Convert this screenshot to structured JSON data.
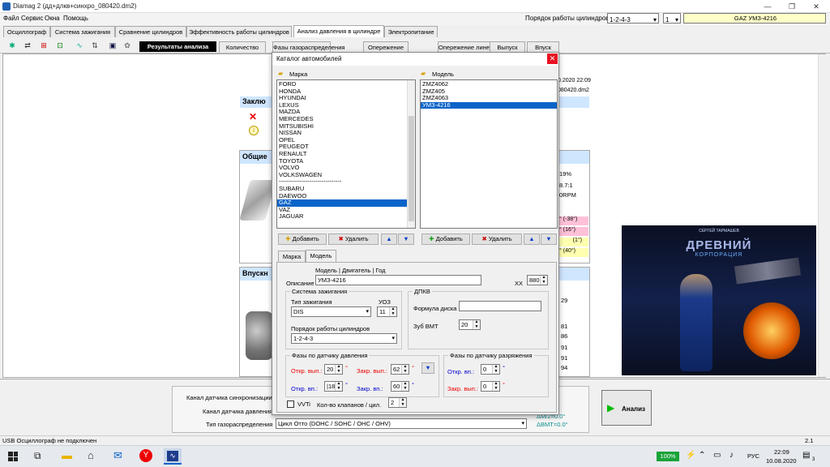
{
  "window": {
    "title": "Diamag 2 (дд+длкв+синхро_080420.dm2)"
  },
  "menu": [
    "Файл",
    "Сервис",
    "Окна",
    "Помощь"
  ],
  "header": {
    "firing_order_label": "Порядок работы цилиндров",
    "firing_order_value": "1-2-4-3",
    "cylinder_value": "1",
    "car_model": "GAZ УМЗ-4216"
  },
  "main_tabs": [
    "Осциллограф",
    "Система зажигания",
    "Сравнение цилиндров",
    "Эффективность работы цилиндров",
    "Анализ давления в цилиндре",
    "Электропитание"
  ],
  "sub_tabs": [
    "Результаты анализа",
    "Количество",
    "Фазы газораспределения",
    "Опережение",
    "Опережение линейно",
    "Выпуск",
    "Впуск"
  ],
  "report": {
    "date": "0.2020 22:09",
    "file": "080420.dm2",
    "conclusion_title": "Заклю",
    "general_title": "Общие",
    "intake_title": "Впускн",
    "values": [
      "19%",
      "8.7:1",
      "0RPM"
    ],
    "angles": [
      "° (-38°)",
      "° (16°)",
      "(1°)",
      "° (40°)"
    ],
    "intake_values": [
      "29",
      "81",
      "86",
      "91",
      "91",
      "94"
    ]
  },
  "bottom": {
    "sync_channel_label": "Канал датчика синхронизации",
    "pressure_channel_label": "Канал датчика давления",
    "timing_label": "Тип газораспределения",
    "timing_value": "Цикл Отто (DOHC / SOHC / OHC / OHV)",
    "deg1": "ΔМ/2=0.0°",
    "deg2": "ΔВМТ=0.0°",
    "analyze_label": "Анализ"
  },
  "status": {
    "left": "USB Осциллограф не подключен",
    "right": "2.1"
  },
  "dialog": {
    "title": "Каталог автомобилей",
    "brand_header": "Марка",
    "model_header": "Модель",
    "brands": [
      "FORD",
      "HONDA",
      "HYUNDAI",
      "LEXUS",
      "MAZDA",
      "MERCEDES",
      "MITSUBISHI",
      "NISSAN",
      "OPEL",
      "PEUGEOT",
      "RENAULT",
      "TOYOTA",
      "VOLVO",
      "VOLKSWAGEN",
      "-------------------------------",
      "SUBARU",
      "DAEWOO",
      "GAZ",
      "VAZ",
      "JAGUAR"
    ],
    "selected_brand": "GAZ",
    "models": [
      "ZMZ4062",
      "ZMZ405",
      "ZMZ4063",
      "УМЗ-4216"
    ],
    "selected_model": "УМЗ-4216",
    "add": "Добавить",
    "delete": "Удалить",
    "tab_brand": "Марка",
    "tab_model": "Модель",
    "desc_header": "Модель | Двигатель | Год",
    "desc_label": "Описание",
    "desc_value": "УМЗ-4216",
    "xx_label": "ХХ",
    "xx_value": "880",
    "ignition": {
      "group": "Система зажигания",
      "type_label": "Тип зажигания",
      "type_value": "DIS",
      "uoz_label": "УОЗ",
      "uoz_value": "11",
      "order_label": "Порядок работы цилиндров",
      "order_value": "1-2-4-3"
    },
    "dpkv": {
      "group": "ДПКВ",
      "formula_label": "Формула диска",
      "formula_value": "",
      "tooth_label": "Зуб ВМТ",
      "tooth_value": "20"
    },
    "pressure_phases": {
      "group": "Фазы по датчику давления",
      "exh_open_label": "Откр. вып.:",
      "exh_open": "20",
      "exh_close_label": "Закр. вып.:",
      "exh_close": "62",
      "int_open_label": "Откр. вп.:",
      "int_open": "|18",
      "int_close_label": "Закр. вп.:",
      "int_close": "60"
    },
    "vacuum_phases": {
      "group": "Фазы по датчику разряжения",
      "int_open_label": "Откр. вп.:",
      "int_open": "0",
      "exh_close_label": "Закр. вып.:",
      "exh_close": "0"
    },
    "vvti_label": "VVTi",
    "valves_label": "Кол-во клапанов / цил.",
    "valves_value": "2"
  },
  "taskbar": {
    "battery": "100%",
    "lang": "РУС",
    "time": "22:09",
    "date": "10.08.2020",
    "notif": "3"
  },
  "cover": {
    "author": "СЕРГЕЙ ТАРМАШЕВ",
    "title": "ДРЕВНИЙ",
    "subtitle": "КОРПОРАЦИЯ"
  }
}
